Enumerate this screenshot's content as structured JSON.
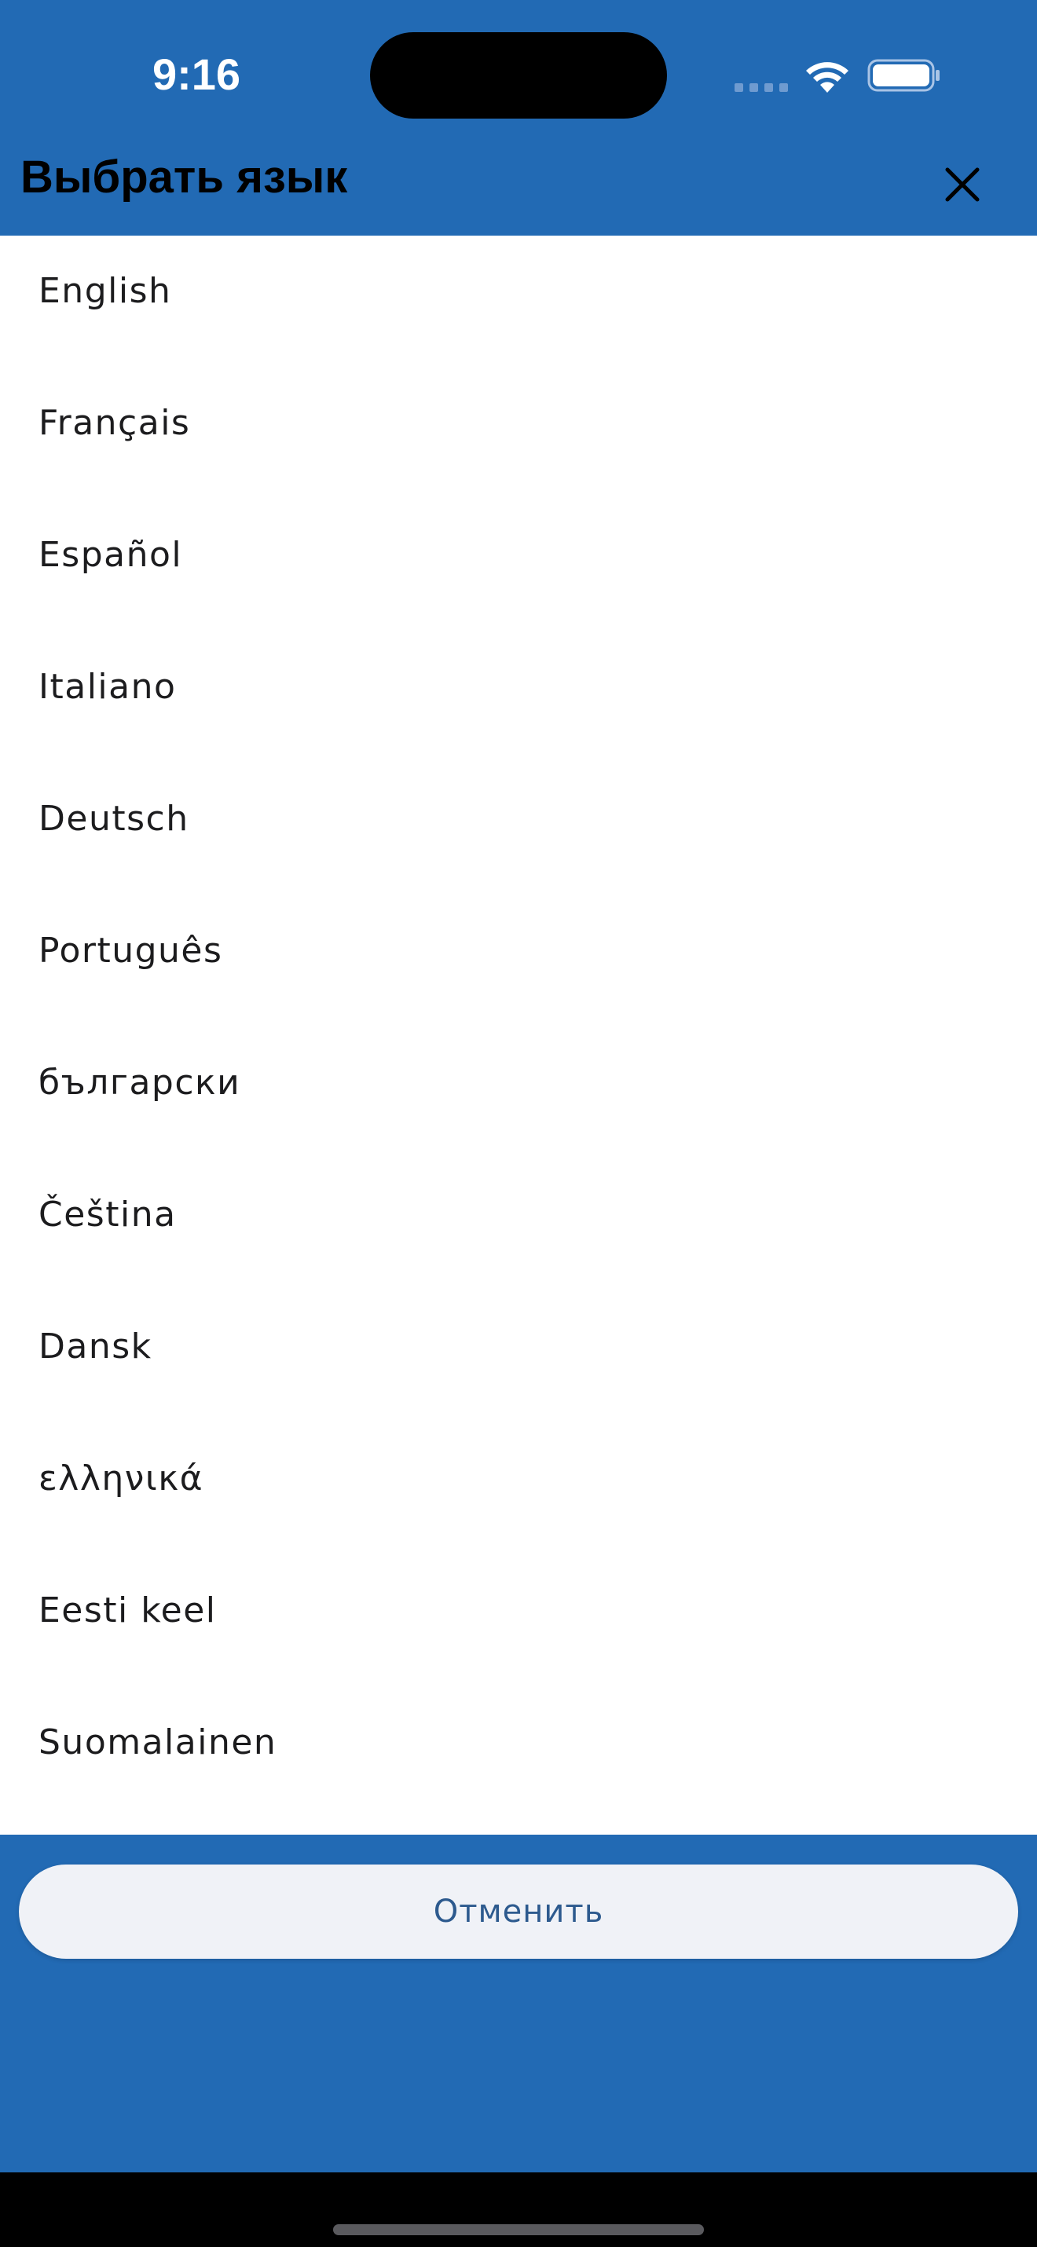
{
  "status_bar": {
    "time": "9:16"
  },
  "header": {
    "title": "Выбрать язык",
    "close_icon": "close-icon"
  },
  "languages": [
    "English",
    "Français",
    "Español",
    "Italiano",
    "Deutsch",
    "Português",
    "български",
    "Čeština",
    "Dansk",
    "ελληνικά",
    "Eesti keel",
    "Suomalainen"
  ],
  "footer": {
    "cancel_label": "Отменить"
  },
  "colors": {
    "accent_blue": "#226ab4",
    "list_background": "#ffffff",
    "button_background": "#f0f2f7",
    "button_text": "#2d5a8e"
  }
}
